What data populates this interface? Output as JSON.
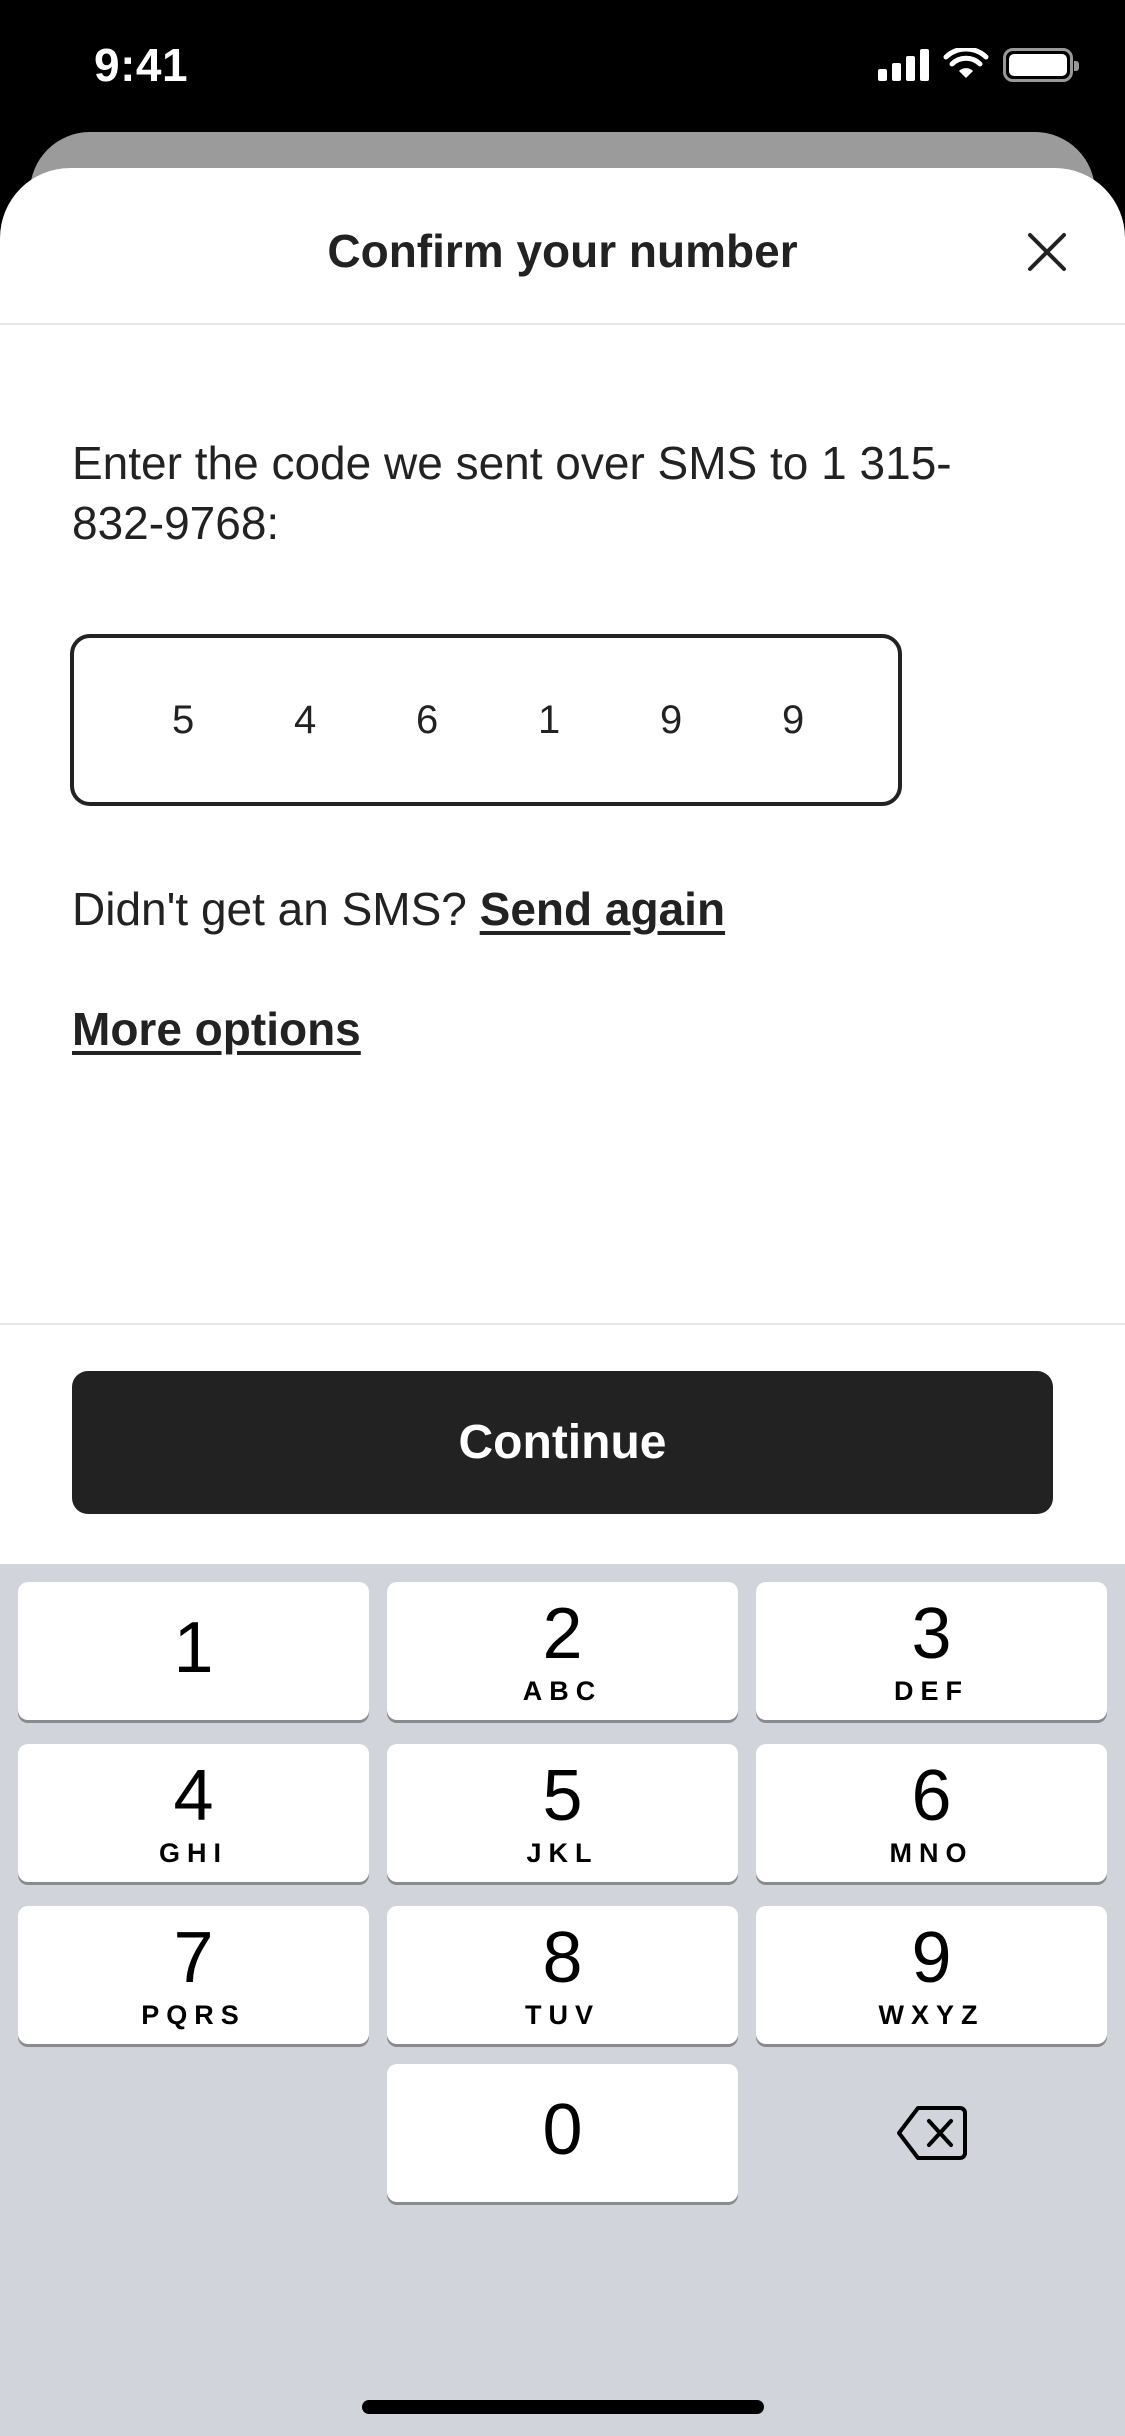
{
  "status_bar": {
    "time": "9:41"
  },
  "sheet": {
    "title": "Confirm your number",
    "prompt": "Enter the code we sent over SMS to 1 315-832-9768:",
    "code_digits": [
      "5",
      "4",
      "6",
      "1",
      "9",
      "9"
    ],
    "resend_text": "Didn't get an SMS?",
    "resend_link": "Send again",
    "more_options": "More options",
    "continue_label": "Continue"
  },
  "keyboard": {
    "keys": [
      {
        "num": "1",
        "letters": ""
      },
      {
        "num": "2",
        "letters": "ABC"
      },
      {
        "num": "3",
        "letters": "DEF"
      },
      {
        "num": "4",
        "letters": "GHI"
      },
      {
        "num": "5",
        "letters": "JKL"
      },
      {
        "num": "6",
        "letters": "MNO"
      },
      {
        "num": "7",
        "letters": "PQRS"
      },
      {
        "num": "8",
        "letters": "TUV"
      },
      {
        "num": "9",
        "letters": "WXYZ"
      },
      {
        "num": "0",
        "letters": ""
      }
    ]
  },
  "icons": {
    "close": "close-icon",
    "backspace": "backspace-icon",
    "signal": "cellular-signal-icon",
    "wifi": "wifi-icon",
    "battery": "battery-icon"
  },
  "colors": {
    "primary_text": "#222222",
    "button_bg": "#222222",
    "keyboard_bg": "#d1d4db"
  }
}
